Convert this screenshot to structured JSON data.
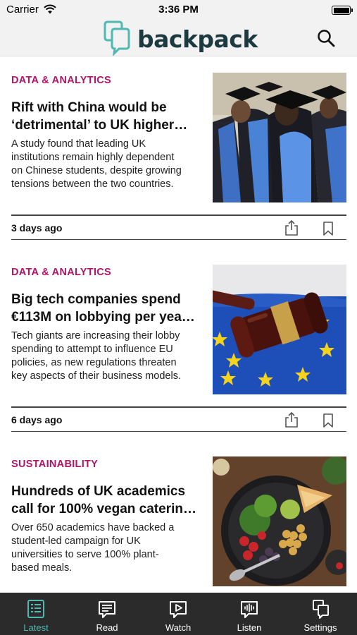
{
  "status_bar": {
    "carrier": "Carrier",
    "time": "3:36 PM"
  },
  "header": {
    "logo_text": "backpack",
    "search_icon": "search-icon"
  },
  "articles": [
    {
      "category": "DATA & ANALYTICS",
      "headline_lines": [
        "Rift with China would be",
        "‘detrimental’ to UK higher…"
      ],
      "summary_lines": [
        "A study found that leading UK",
        "institutions remain highly dependent",
        "on Chinese students, despite growing",
        "tensions between the two countries."
      ],
      "age": "3 days ago",
      "image": "graduates-in-caps-and-gowns"
    },
    {
      "category": "DATA & ANALYTICS",
      "headline_lines": [
        "Big tech companies spend",
        "€113M on lobbying per yea…"
      ],
      "summary_lines": [
        "Tech giants are increasing their lobby",
        "spending to attempt to influence EU",
        "policies, as new regulations threaten",
        "key aspects of their business models."
      ],
      "age": "6 days ago",
      "image": "gavel-on-eu-flag"
    },
    {
      "category": "SUSTAINABILITY",
      "headline_lines": [
        "Hundreds of UK academics",
        "call for 100% vegan caterin…"
      ],
      "summary_lines": [
        "Over 650 academics have backed a",
        "student-led campaign for UK",
        "universities to serve 100% plant-",
        "based meals."
      ],
      "age": "",
      "image": "vegan-salad-bowl"
    }
  ],
  "tabs": [
    {
      "label": "Latest",
      "icon": "list-icon",
      "active": true
    },
    {
      "label": "Read",
      "icon": "read-icon",
      "active": false
    },
    {
      "label": "Watch",
      "icon": "play-icon",
      "active": false
    },
    {
      "label": "Listen",
      "icon": "audio-wave-icon",
      "active": false
    },
    {
      "label": "Settings",
      "icon": "settings-icon",
      "active": false
    }
  ],
  "colors": {
    "accent": "#4fb9b2",
    "category": "#b0146b",
    "logo": "#1d3a40",
    "tab_bar": "#2b2b2b"
  }
}
